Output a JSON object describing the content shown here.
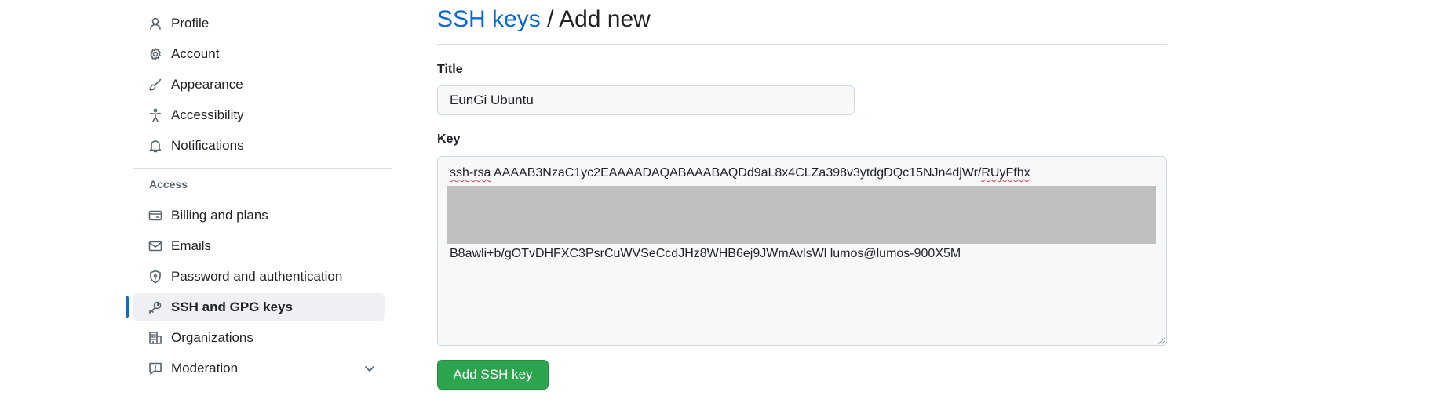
{
  "sidebar": {
    "items": [
      {
        "label": "Profile",
        "icon": "person-icon"
      },
      {
        "label": "Account",
        "icon": "gear-icon"
      },
      {
        "label": "Appearance",
        "icon": "paintbrush-icon"
      },
      {
        "label": "Accessibility",
        "icon": "accessibility-icon"
      },
      {
        "label": "Notifications",
        "icon": "bell-icon"
      }
    ],
    "access_heading": "Access",
    "access_items": [
      {
        "label": "Billing and plans",
        "icon": "credit-card-icon"
      },
      {
        "label": "Emails",
        "icon": "mail-icon"
      },
      {
        "label": "Password and authentication",
        "icon": "shield-lock-icon"
      },
      {
        "label": "SSH and GPG keys",
        "icon": "key-icon",
        "active": true
      },
      {
        "label": "Organizations",
        "icon": "organization-icon"
      },
      {
        "label": "Moderation",
        "icon": "report-icon"
      }
    ]
  },
  "header": {
    "breadcrumb_link": "SSH keys",
    "breadcrumb_current": "/ Add new"
  },
  "form": {
    "title_label": "Title",
    "title_value": "EunGi Ubuntu",
    "key_label": "Key",
    "key_prefix": "ssh-rsa",
    "key_line1_middle": " AAAAB3NzaC1yc2EAAAADAQABAAABAQDd9aL8x4CLZa398v3ytdgDQc15NJn4djWr/",
    "key_line1_end": "RUyFfhx",
    "key_line_last": "B8awli+b/gOTvDHFXC3PsrCuWVSeCcdJHz8WHB6ej9JWmAvlsWl lumos@lumos-900X5M",
    "submit_label": "Add SSH key"
  },
  "colors": {
    "accent": "#0969da",
    "primary_button": "#2da44e",
    "redaction": "#bfbfbf"
  }
}
